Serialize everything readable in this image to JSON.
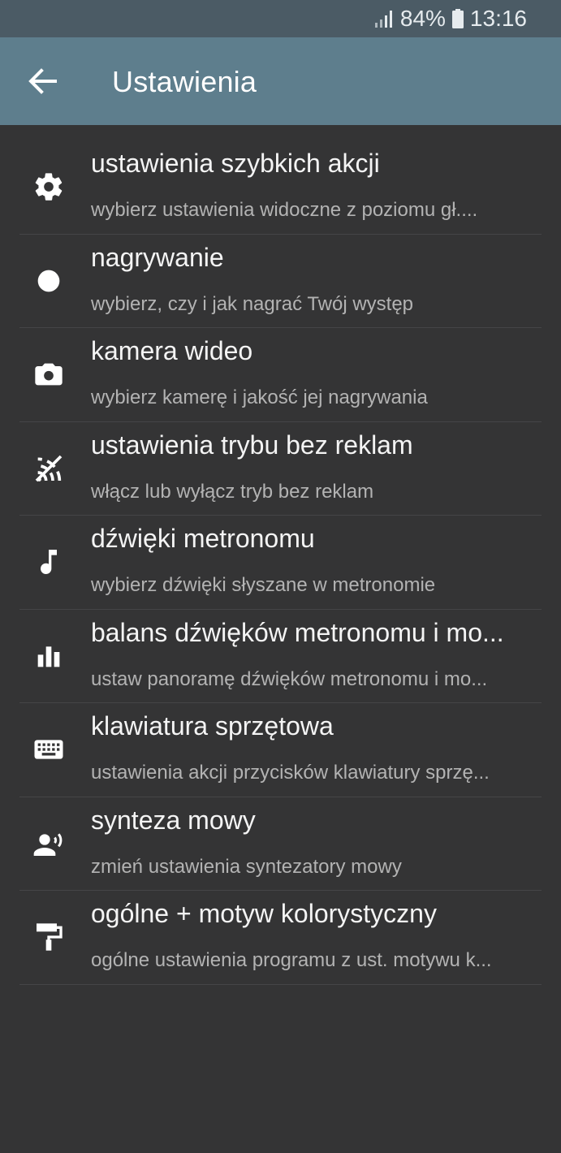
{
  "status": {
    "battery": "84%",
    "time": "13:16"
  },
  "appbar": {
    "title": "Ustawienia",
    "back_icon": "arrow-back-icon"
  },
  "items": [
    {
      "icon": "gear-icon",
      "title": "ustawienia szybkich akcji",
      "subtitle": "wybierz ustawienia widoczne z poziomu gł...."
    },
    {
      "icon": "record-dot-icon",
      "title": "nagrywanie",
      "subtitle": "wybierz, czy i jak nagrać Twój występ"
    },
    {
      "icon": "camera-icon",
      "title": "kamera wideo",
      "subtitle": "wybierz kamerę i jakość jej nagrywania"
    },
    {
      "icon": "no-ads-icon",
      "title": "ustawienia trybu bez reklam",
      "subtitle": "włącz lub wyłącz tryb bez reklam"
    },
    {
      "icon": "music-note-icon",
      "title": "dźwięki metronomu",
      "subtitle": "wybierz dźwięki słyszane w metronomie"
    },
    {
      "icon": "bar-chart-icon",
      "title": "balans dźwięków metronomu i mo...",
      "subtitle": "ustaw panoramę dźwięków metronomu i mo..."
    },
    {
      "icon": "keyboard-icon",
      "title": "klawiatura sprzętowa",
      "subtitle": "ustawienia akcji przycisków klawiatury sprzę..."
    },
    {
      "icon": "speech-icon",
      "title": "synteza mowy",
      "subtitle": "zmień ustawienia syntezatory mowy"
    },
    {
      "icon": "paint-roller-icon",
      "title": "ogólne + motyw kolorystyczny",
      "subtitle": "ogólne ustawienia programu z ust. motywu k..."
    }
  ]
}
